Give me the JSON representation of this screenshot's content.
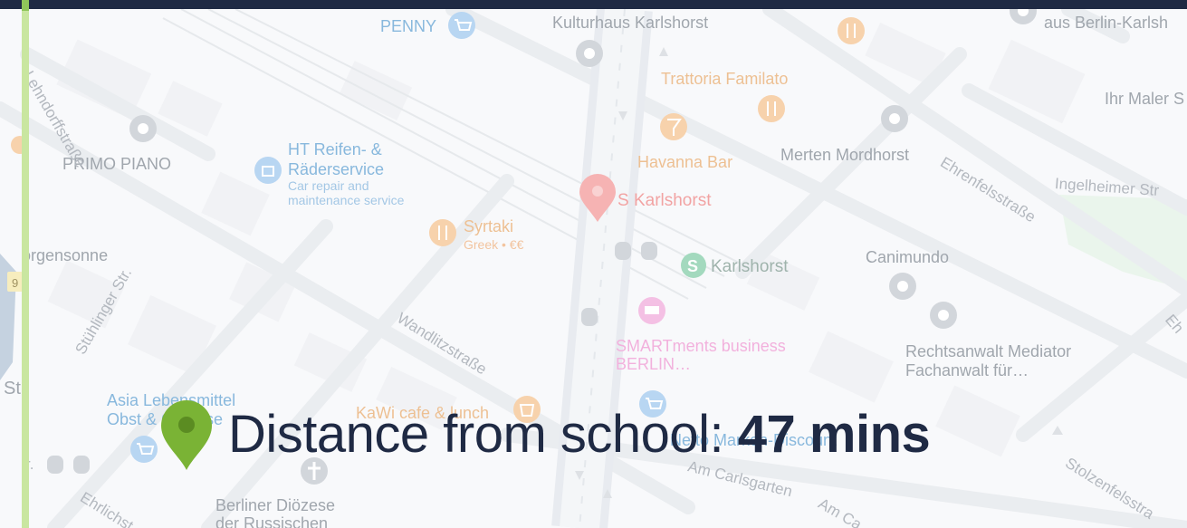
{
  "map": {
    "pois": [
      {
        "id": "penny",
        "label": "PENNY"
      },
      {
        "id": "kulturhaus",
        "label": "Kulturhaus Karlshorst"
      },
      {
        "id": "aus-berlin",
        "label": "aus Berlin-Karlsh"
      },
      {
        "id": "trattoria",
        "label": "Trattoria Familato"
      },
      {
        "id": "ihr-maler",
        "label": "Ihr Maler S"
      },
      {
        "id": "primo-piano",
        "label": "PRIMO PIANO"
      },
      {
        "id": "ht-reifen",
        "label": "HT Reifen- &\nRäderservice"
      },
      {
        "id": "havanna",
        "label": "Havanna Bar"
      },
      {
        "id": "merten",
        "label": "Merten Mordhorst"
      },
      {
        "id": "s-karlshorst",
        "label": "S Karlshorst"
      },
      {
        "id": "syrtaki",
        "label": "Syrtaki"
      },
      {
        "id": "orgensonne",
        "label": "orgensonne"
      },
      {
        "id": "karlshorst-station",
        "label": "Karlshorst"
      },
      {
        "id": "canimundo",
        "label": "Canimundo"
      },
      {
        "id": "smartments",
        "label": "SMARTments business\nBERLIN…"
      },
      {
        "id": "rechtsanwalt",
        "label": "Rechtsanwalt Mediator\nFachanwalt für…"
      },
      {
        "id": "asia",
        "label": "Asia Lebensmittel\nObst & Gemüse"
      },
      {
        "id": "kawi",
        "label": "KaWi cafe & lunch"
      },
      {
        "id": "berliner",
        "label": "Berliner Diözese\nder Russischen"
      },
      {
        "id": "st",
        "label": "St"
      },
      {
        "id": "netto",
        "label": "Netto Marken-Discount"
      }
    ],
    "poi_subtitles": {
      "ht-reifen": "Car repair and\nmaintenance service",
      "syrtaki": "Greek • €€"
    },
    "streets": [
      {
        "id": "lehndorff",
        "label": "Lehndorffstraße"
      },
      {
        "id": "stuhlinger",
        "label": "Stühlinger Str."
      },
      {
        "id": "wandlitz",
        "label": "Wandlitzstraße"
      },
      {
        "id": "ehrenfels",
        "label": "Ehrenfelsstraße"
      },
      {
        "id": "ingelheimer",
        "label": "Ingelheimer Str"
      },
      {
        "id": "am-carlsgarten",
        "label": "Am Carlsgarten"
      },
      {
        "id": "am-c",
        "label": "Am Ca"
      },
      {
        "id": "stolzenfels",
        "label": "Stolzenfelsstra"
      },
      {
        "id": "ehrlich",
        "label": "Ehrlichst"
      },
      {
        "id": "eh",
        "label": "Eh"
      },
      {
        "id": "r-dot",
        "label": "r."
      }
    ],
    "route_badge": "9",
    "colors": {
      "topbar": "#1f2a44",
      "school_pin": "#7ab335",
      "station_pin": "#f08a8a",
      "transit_green": "#3a9e6a",
      "route_line": "#c9e6a0"
    }
  },
  "overlay": {
    "distance_label": "Distance from school: ",
    "distance_value": "47 mins"
  }
}
